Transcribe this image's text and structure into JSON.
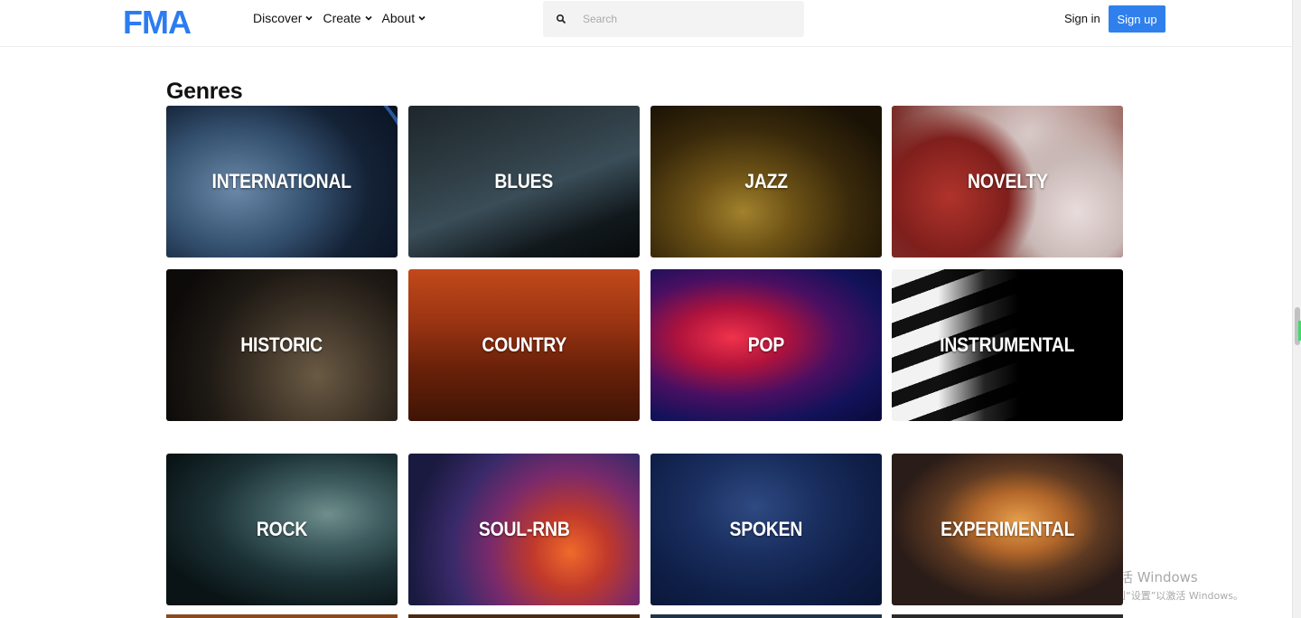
{
  "header": {
    "logo": "FMA",
    "nav": [
      {
        "label": "Discover"
      },
      {
        "label": "Create"
      },
      {
        "label": "About"
      }
    ],
    "search": {
      "placeholder": "Search",
      "value": ""
    },
    "sign_in": "Sign in",
    "sign_up": "Sign up"
  },
  "page": {
    "title": "Genres"
  },
  "genres": [
    {
      "label": "INTERNATIONAL"
    },
    {
      "label": "BLUES"
    },
    {
      "label": "JAZZ"
    },
    {
      "label": "NOVELTY"
    },
    {
      "label": "HISTORIC"
    },
    {
      "label": "COUNTRY"
    },
    {
      "label": "POP"
    },
    {
      "label": "INSTRUMENTAL"
    },
    {
      "label": "ROCK"
    },
    {
      "label": "SOUL-RNB"
    },
    {
      "label": "SPOKEN"
    },
    {
      "label": "EXPERIMENTAL"
    }
  ],
  "watermark": {
    "line1": "激活 Windows",
    "line2": "转到“设置”以激活 Windows。"
  },
  "colors": {
    "brand": "#2b7cf1",
    "signup_bg": "#2f80ed"
  }
}
